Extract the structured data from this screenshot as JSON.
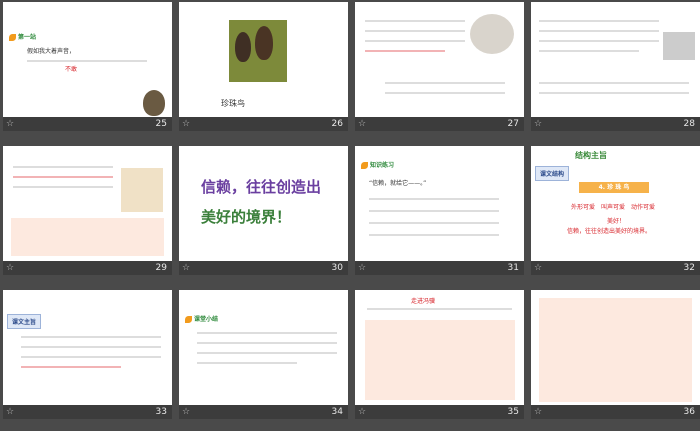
{
  "slides": [
    {
      "num": "25",
      "tag": "第一站",
      "text1": "假如我大着声",
      "text2": "音，",
      "text3": "不敢"
    },
    {
      "num": "26",
      "caption": "珍珠鸟 "
    },
    {
      "num": "27"
    },
    {
      "num": "28"
    },
    {
      "num": "29"
    },
    {
      "num": "30",
      "slogan_l1": "信赖，往往创造出",
      "slogan_l2": "美好的境界！"
    },
    {
      "num": "31",
      "tag": "知识练习",
      "q": "“信赖，就给它——。”"
    },
    {
      "num": "32",
      "title": "结构主旨",
      "side": "课文结构",
      "item": "4. 珍 珠 鸟",
      "c1": "外形可爱",
      "c2": "叫声可爱",
      "c3": "动作可爱",
      "c4": "美好！",
      "c5": "信赖，往往创造出美好的境界。"
    },
    {
      "num": "33",
      "box": "课文主旨"
    },
    {
      "num": "34",
      "box": "课堂小结"
    },
    {
      "num": "35",
      "title": "走进冯骥"
    },
    {
      "num": "36"
    }
  ]
}
